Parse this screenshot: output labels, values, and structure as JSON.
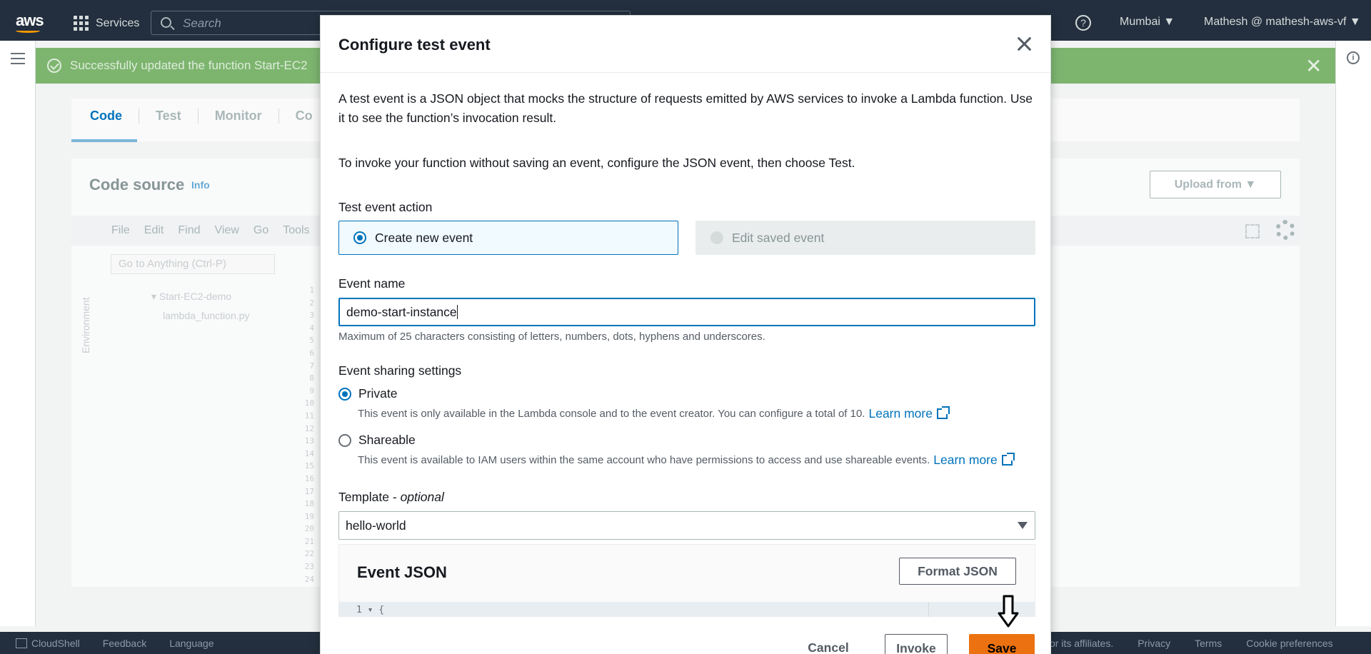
{
  "console": {
    "logo": "aws",
    "services_label": "Services",
    "search_placeholder": "Search",
    "help_symbol": "?",
    "region": "Mumbai ▼",
    "account": "Mathesh @ mathesh-aws-vf ▼",
    "flash_message": "Successfully updated the function Start-EC2",
    "flash_close": "✕",
    "tabs": [
      "Code",
      "Test",
      "Monitor",
      "Co"
    ],
    "code_source_title": "Code source",
    "code_source_info": "Info",
    "upload_label": "Upload from ▼",
    "menus": [
      "File",
      "Edit",
      "Find",
      "View",
      "Go",
      "Tools"
    ],
    "goto_placeholder": "Go to Anything (Ctrl-P)",
    "environment_label": "Environment",
    "tree_root": "▾ Start-EC2-demo",
    "tree_file": "lambda_function.py",
    "gutter_lines": "1\n2\n3\n4\n5\n6\n7\n8\n9\n10\n11\n12\n13\n14\n15\n16\n17\n18\n19\n20\n21\n22\n23\n24",
    "bottom_left": [
      "CloudShell",
      "Feedback",
      "Language"
    ],
    "bottom_right": [
      "or its affiliates.",
      "Privacy",
      "Terms",
      "Cookie preferences"
    ]
  },
  "modal": {
    "title": "Configure test event",
    "description": "A test event is a JSON object that mocks the structure of requests emitted by AWS services to invoke a Lambda function. Use it to see the function’s invocation result.",
    "invoke_note": "To invoke your function without saving an event, configure the JSON event, then choose Test.",
    "test_event_action_label": "Test event action",
    "action_create": "Create new event",
    "action_edit": "Edit saved event",
    "event_name_label": "Event name",
    "event_name_value": "demo-start-instance",
    "event_name_hint": "Maximum of 25 characters consisting of letters, numbers, dots, hyphens and underscores.",
    "sharing_label": "Event sharing settings",
    "private_label": "Private",
    "private_desc": "This event is only available in the Lambda console and to the event creator. You can configure a total of 10.",
    "shareable_label": "Shareable",
    "shareable_desc": "This event is available to IAM users within the same account who have permissions to access and use shareable events.",
    "learn_more": "Learn more",
    "template_label": "Template - ",
    "template_optional": "optional",
    "template_value": "hello-world",
    "event_json_title": "Event JSON",
    "format_json": "Format JSON",
    "editor_first_line": "1 ▾  {",
    "cancel": "Cancel",
    "invoke": "Invoke",
    "save": "Save"
  },
  "colors": {
    "primary_action": "#ec7211",
    "link": "#0073bb",
    "nav_bg": "#232f3e"
  }
}
